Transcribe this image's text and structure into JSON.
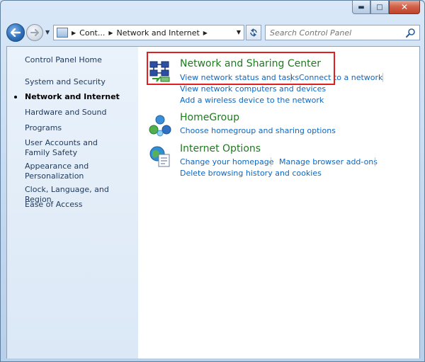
{
  "window": {
    "caption": {
      "minimize": "▬",
      "maximize": "□",
      "close": "✕"
    }
  },
  "nav": {
    "breadcrumb": [
      "Cont...",
      "Network and Internet"
    ],
    "search_placeholder": "Search Control Panel"
  },
  "sidebar": {
    "home": "Control Panel Home",
    "items": [
      {
        "label": "System and Security",
        "active": false
      },
      {
        "label": "Network and Internet",
        "active": true
      },
      {
        "label": "Hardware and Sound",
        "active": false
      },
      {
        "label": "Programs",
        "active": false
      },
      {
        "label": "User Accounts and Family Safety",
        "active": false
      },
      {
        "label": "Appearance and Personalization",
        "active": false
      },
      {
        "label": "Clock, Language, and Region",
        "active": false
      },
      {
        "label": "Ease of Access",
        "active": false
      }
    ]
  },
  "categories": [
    {
      "title": "Network and Sharing Center",
      "icon": "network-sharing-icon",
      "tasks": [
        "View network status and tasks",
        "Connect to a network",
        "View network computers and devices",
        "Add a wireless device to the network"
      ]
    },
    {
      "title": "HomeGroup",
      "icon": "homegroup-icon",
      "tasks": [
        "Choose homegroup and sharing options"
      ]
    },
    {
      "title": "Internet Options",
      "icon": "internet-options-icon",
      "tasks": [
        "Change your homepage",
        "Manage browser add-ons",
        "Delete browsing history and cookies"
      ]
    }
  ],
  "colors": {
    "title_green": "#1f7a1f",
    "link_blue": "#0e66c0",
    "highlight_red": "#e02020"
  }
}
